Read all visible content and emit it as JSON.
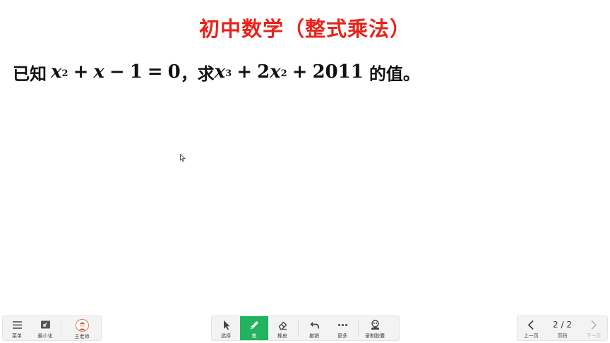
{
  "slide": {
    "title": "初中数学（整式乘法）",
    "problem": {
      "given_prefix": "已知",
      "eq1_terms": [
        "x",
        "2",
        "+",
        "x",
        "−",
        "1",
        "=",
        "0"
      ],
      "comma": "，求",
      "eq2_terms": [
        "x",
        "3",
        "+",
        "2",
        "x",
        "2",
        "+",
        "2011"
      ],
      "suffix": "的值。"
    }
  },
  "toolbar": {
    "left": {
      "menu_label": "菜单",
      "minimize_label": "最小化",
      "teacher_label": "王老师"
    },
    "center": {
      "select_label": "选择",
      "pen_label": "笔",
      "eraser_label": "橡皮",
      "undo_label": "撤销",
      "more_label": "更多",
      "record_label": "录制胶囊"
    },
    "right": {
      "prev_label": "上一页",
      "page_text": "2 / 2",
      "page_label": "页码",
      "next_label": "下一页"
    }
  },
  "colors": {
    "title": "#e8231b",
    "active_tool": "#22b35e",
    "toolbar_bg": "#f3f3f3"
  }
}
